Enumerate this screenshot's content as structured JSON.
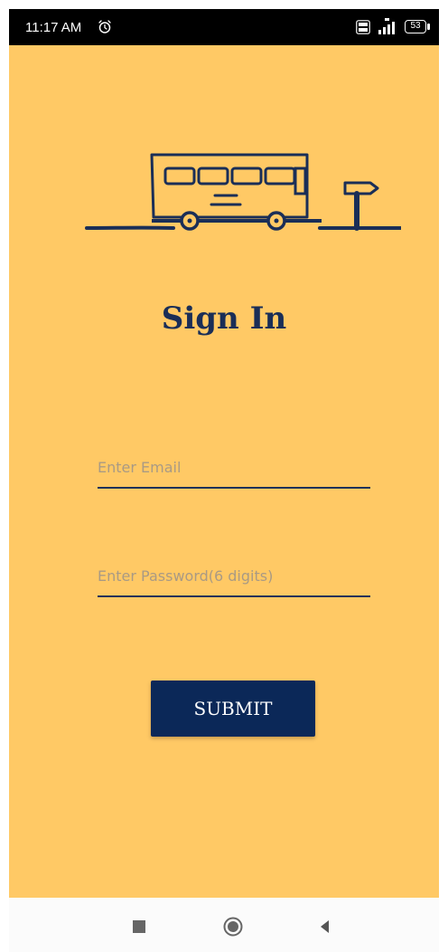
{
  "status_bar": {
    "time": "11:17 AM",
    "battery": "53",
    "icons": [
      "alarm-icon",
      "volte-icon",
      "signal-icon",
      "battery-icon"
    ]
  },
  "screen": {
    "title": "Sign In",
    "logo": "bus-logo",
    "email_placeholder": "Enter Email",
    "email_value": "",
    "password_placeholder": "Enter Password(6 digits)",
    "password_value": "",
    "submit_label": "SUBMIT"
  },
  "nav_bar": {
    "items": [
      "recents-square-icon",
      "home-circle-icon",
      "back-triangle-icon"
    ]
  },
  "colors": {
    "background": "#ffc965",
    "accent": "#0b2858",
    "title": "#1a2e57",
    "placeholder": "#a99a84",
    "status_bar": "#000000",
    "nav_bar": "#fbfbfb"
  }
}
